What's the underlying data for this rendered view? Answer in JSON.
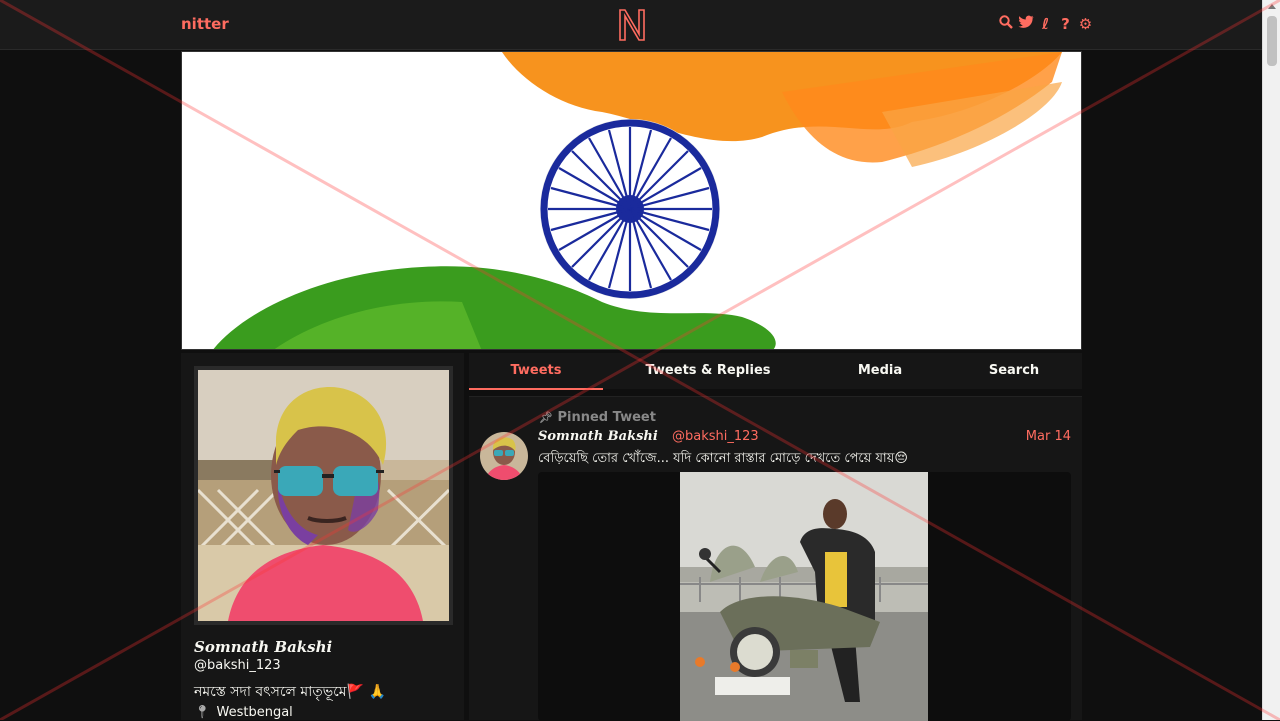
{
  "navbar": {
    "brand": "nitter",
    "icons": [
      "search-icon",
      "bird-icon",
      "rss-icon",
      "help-icon",
      "gear-icon"
    ],
    "accent": "#ff6c60"
  },
  "profile": {
    "fullname": "Somnath Bakshi",
    "username": "@bakshi_123",
    "bio": "নমস্তে সদা বৎসলে মাতৃভূমে🚩 🙏",
    "location": "Westbengal"
  },
  "tabs": [
    {
      "label": "Tweets",
      "active": true
    },
    {
      "label": "Tweets & Replies",
      "active": false
    },
    {
      "label": "Media",
      "active": false
    },
    {
      "label": "Search",
      "active": false
    }
  ],
  "tweet": {
    "pinned_label": "Pinned Tweet",
    "fullname": "Somnath Bakshi",
    "username": "@bakshi_123",
    "date": "Mar 14",
    "text": "বেড়িয়েছি তোর খোঁজে... যদি কোনো রাস্তার মোড়ে দেখতে পেয়ে যায়😔"
  },
  "colors": {
    "background": "#0f0f0f",
    "panel": "#161616",
    "accent": "#ff6c60"
  }
}
